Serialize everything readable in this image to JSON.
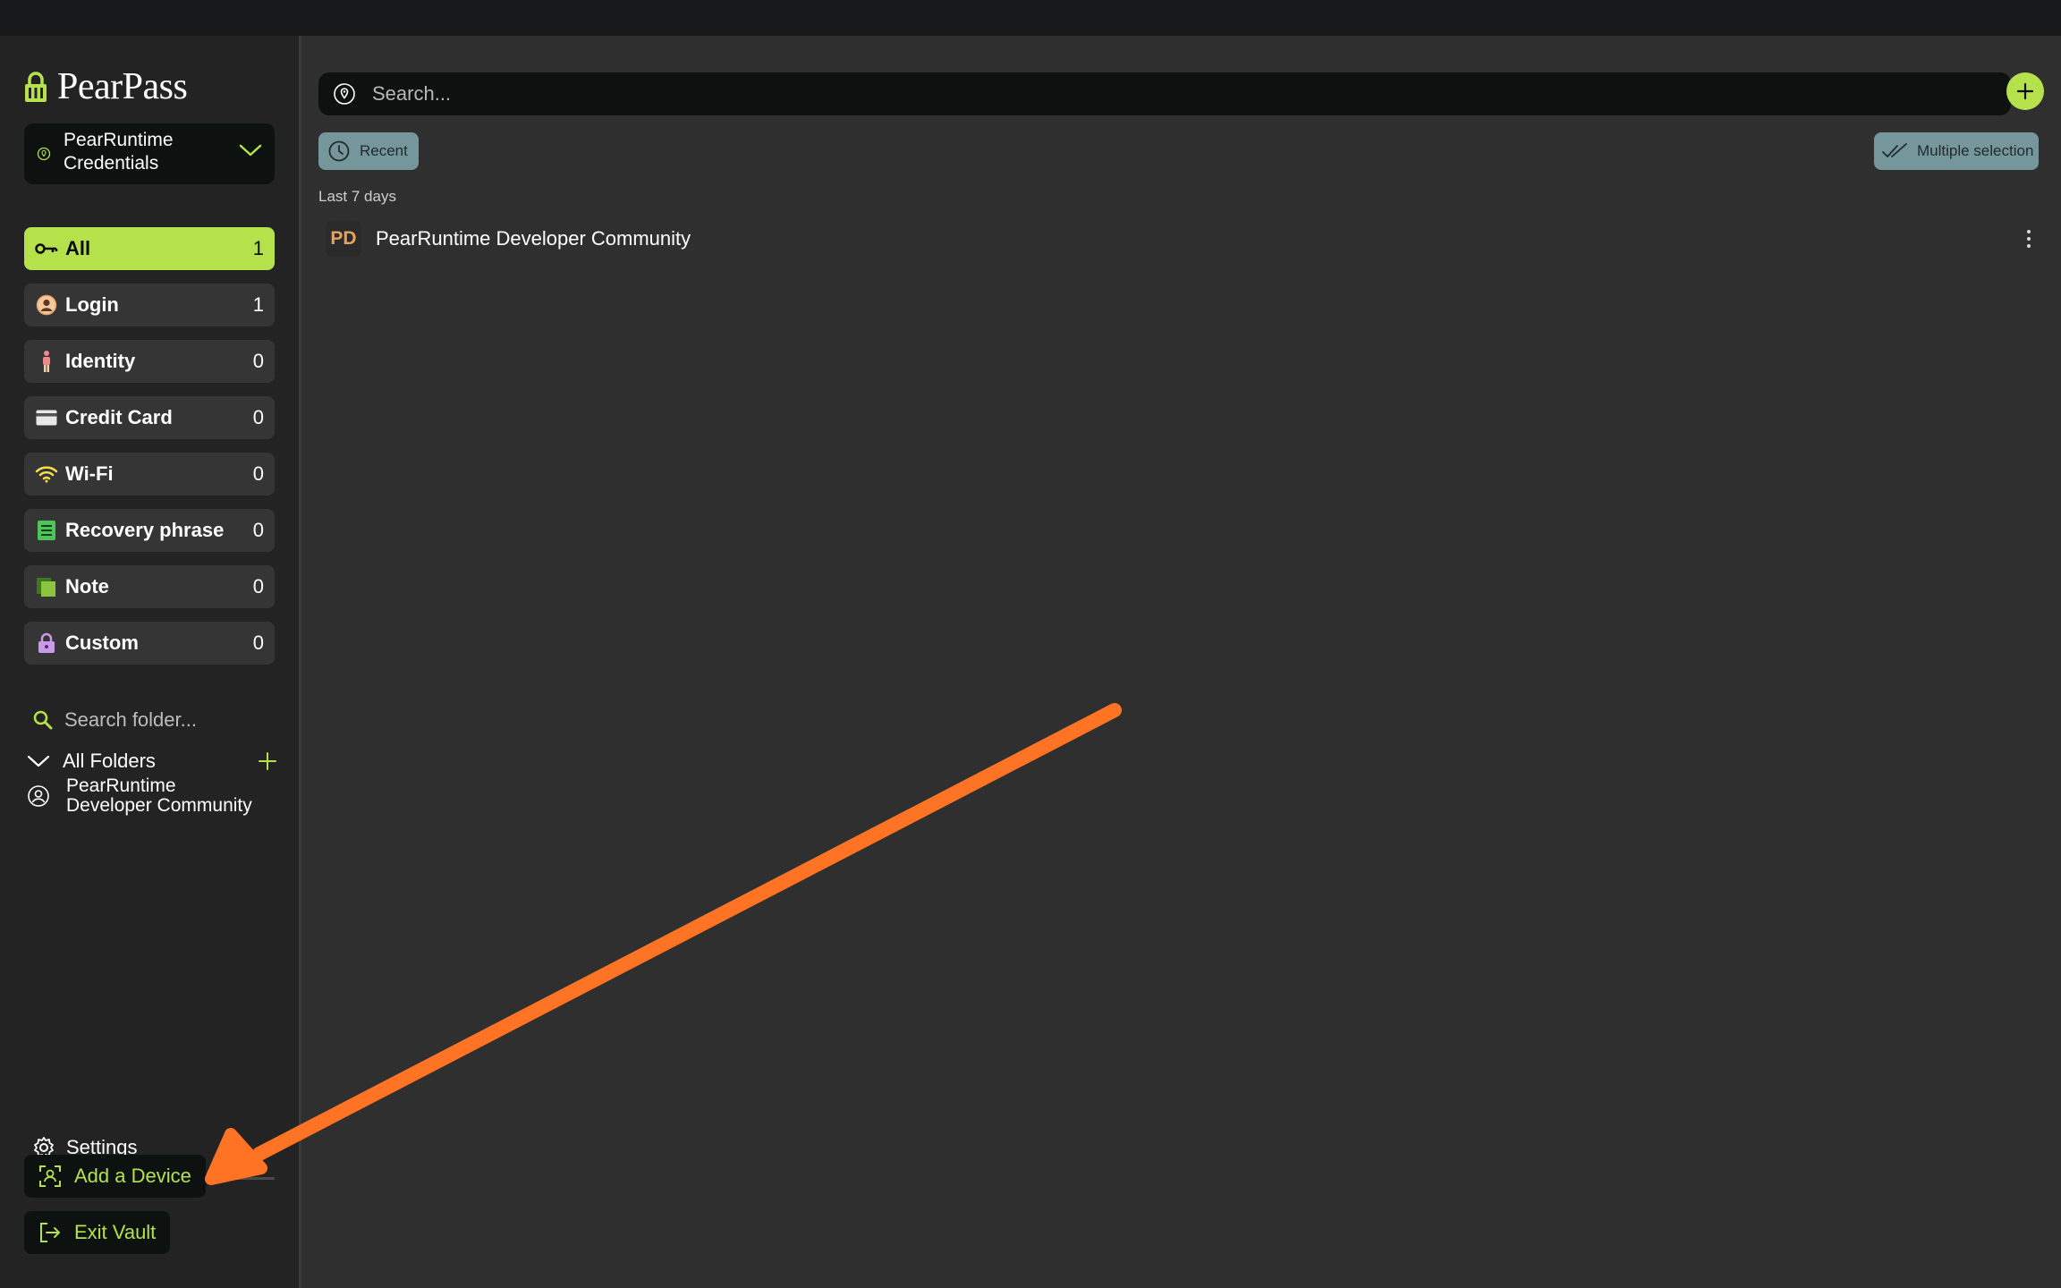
{
  "app": {
    "name": "PearPass"
  },
  "vault": {
    "name": "PearRuntime\nCredentials"
  },
  "categories": [
    {
      "label": "All",
      "count": "1",
      "icon": "key-icon",
      "active": true
    },
    {
      "label": "Login",
      "count": "1",
      "icon": "user-circle-icon"
    },
    {
      "label": "Identity",
      "count": "0",
      "icon": "person-icon"
    },
    {
      "label": "Credit Card",
      "count": "0",
      "icon": "credit-card-icon"
    },
    {
      "label": "Wi-Fi",
      "count": "0",
      "icon": "wifi-icon"
    },
    {
      "label": "Recovery phrase",
      "count": "0",
      "icon": "document-list-icon"
    },
    {
      "label": "Note",
      "count": "0",
      "icon": "note-icon"
    },
    {
      "label": "Custom",
      "count": "0",
      "icon": "lock-icon"
    }
  ],
  "folders": {
    "search_placeholder": "Search folder...",
    "all_label": "All Folders",
    "items": [
      {
        "label": "PearRuntime\nDeveloper Community"
      }
    ]
  },
  "bottom": {
    "settings_label": "Settings",
    "add_device_label": "Add a Device",
    "exit_label": "Exit Vault"
  },
  "main": {
    "search_placeholder": "Search...",
    "recent_label": "Recent",
    "multi_label": "Multiple selection",
    "section_label": "Last 7 days",
    "records": [
      {
        "initials": "PD",
        "title": "PearRuntime Developer Community"
      }
    ]
  },
  "colors": {
    "accent": "#b5e24a",
    "annotation_arrow": "#ff7424",
    "chip": "#75969a",
    "background": "#2f2f2f",
    "sidebar": "#232323"
  }
}
